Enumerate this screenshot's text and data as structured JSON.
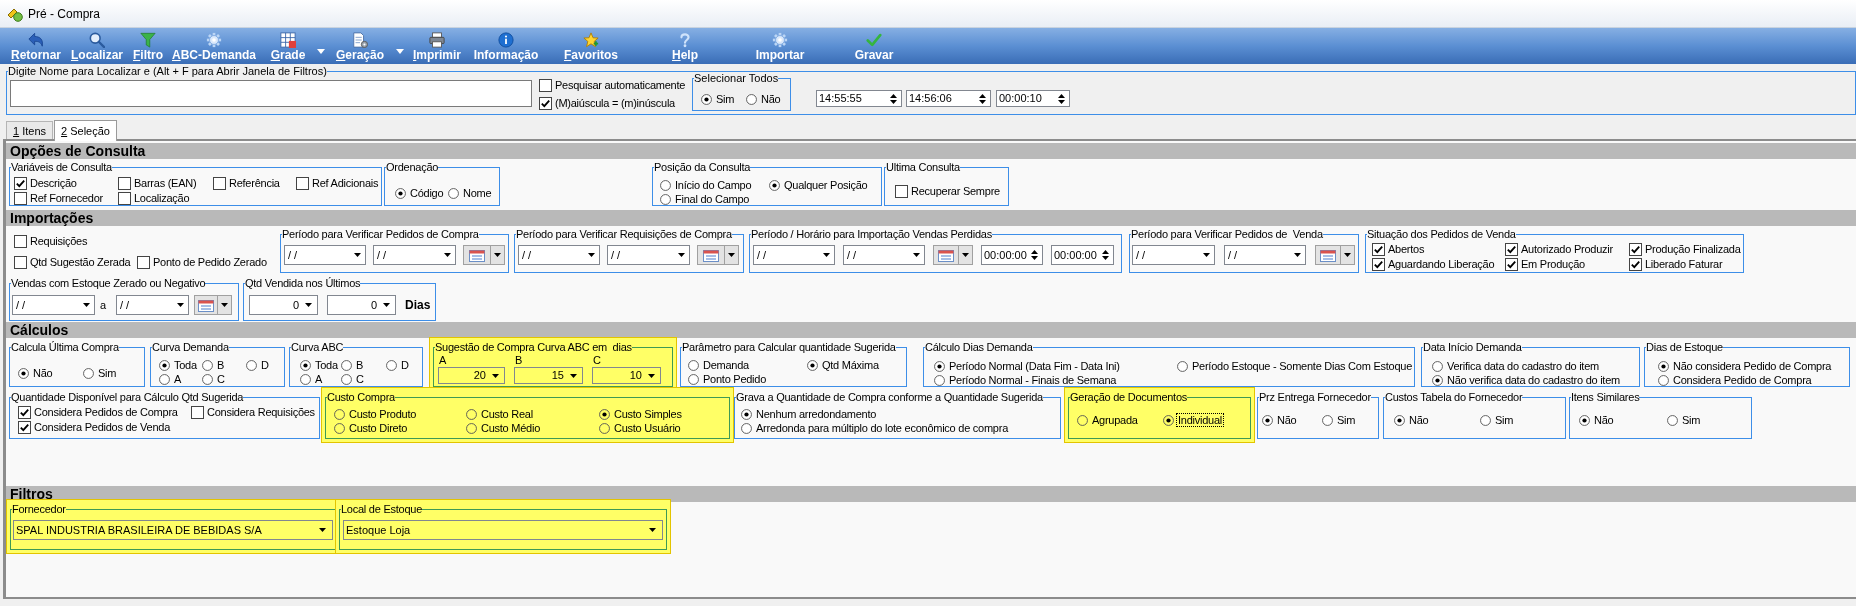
{
  "window": {
    "title": "Pré - Compra"
  },
  "toolbar": [
    {
      "label": "Retornar",
      "mnemonic": true,
      "menu": false
    },
    {
      "label": "Localizar",
      "mnemonic": true,
      "menu": false
    },
    {
      "label": "Filtro",
      "mnemonic": true,
      "menu": false
    },
    {
      "label": "ABC-Demanda",
      "mnemonic": true,
      "menu": false
    },
    {
      "label": "Grade",
      "mnemonic": true,
      "menu": true
    },
    {
      "label": "Geração",
      "mnemonic": true,
      "menu": true
    },
    {
      "label": "Imprimir",
      "mnemonic": true,
      "menu": false
    },
    {
      "label": "Informação",
      "mnemonic": false,
      "menu": false
    },
    {
      "label": "Favoritos",
      "mnemonic": true,
      "menu": false
    },
    {
      "label": "Help",
      "mnemonic": true,
      "menu": false
    },
    {
      "label": "Importar",
      "mnemonic": false,
      "menu": false
    },
    {
      "label": "Gravar",
      "mnemonic": false,
      "menu": false
    }
  ],
  "search": {
    "label": "Digite Nome para Localizar e (Alt + F para Abrir Janela de Filtros)",
    "options": [
      {
        "label": "Pesquisar automaticamente",
        "checked": false
      },
      {
        "label": "(M)aiúscula = (m)inúscula",
        "checked": true
      }
    ],
    "select_all": {
      "title": "Selecionar Todos",
      "options": [
        {
          "label": "Sim",
          "selected": true
        },
        {
          "label": "Não",
          "selected": false
        }
      ]
    },
    "times": [
      "14:55:55",
      "14:56:06",
      "00:00:10"
    ]
  },
  "tabs": [
    {
      "label": "1 Itens",
      "selected": false,
      "mnemonic": true
    },
    {
      "label": "2 Seleção",
      "selected": true,
      "mnemonic": true
    }
  ],
  "sections": [
    {
      "title": "Opções de Consulta",
      "rows": [
        {
          "groups": [
            {
              "title": "Variáveis de Consulta",
              "highlighted": false,
              "lines": [
                [
                  {
                    "kind": "checkbox",
                    "label": "Descrição",
                    "checked": true
                  },
                  {
                    "kind": "checkbox",
                    "label": "Barras (EAN)",
                    "checked": false
                  },
                  {
                    "kind": "checkbox",
                    "label": "Referência",
                    "checked": false
                  },
                  {
                    "kind": "checkbox",
                    "label": "Ref Adicionais",
                    "checked": false
                  }
                ],
                [
                  {
                    "kind": "checkbox",
                    "label": "Ref Fornecedor",
                    "checked": false
                  },
                  {
                    "kind": "checkbox",
                    "label": "Localização",
                    "checked": false
                  }
                ]
              ]
            },
            {
              "title": "Ordenação",
              "highlighted": false,
              "lines": [
                [
                  {
                    "kind": "radio",
                    "label": "Código",
                    "selected": true
                  },
                  {
                    "kind": "radio",
                    "label": "Nome",
                    "selected": false
                  }
                ]
              ]
            },
            {
              "title": "Posição da Consulta",
              "highlighted": false,
              "lines": [
                [
                  {
                    "kind": "radio",
                    "label": "Início do Campo",
                    "selected": false
                  },
                  {
                    "kind": "radio",
                    "label": "Qualquer Posição",
                    "selected": true
                  }
                ],
                [
                  {
                    "kind": "radio",
                    "label": "Final do Campo",
                    "selected": false
                  }
                ]
              ]
            },
            {
              "title": "Ultima Consulta",
              "highlighted": false,
              "lines": [
                [
                  {
                    "kind": "checkbox",
                    "label": "Recuperar Sempre",
                    "checked": false
                  }
                ]
              ]
            }
          ]
        }
      ]
    },
    {
      "title": "Importações",
      "rows": [
        {
          "groups": [
            {
              "lines": [
                [
                  {
                    "kind": "checkbox",
                    "label": "Requisições",
                    "checked": false
                  }
                ],
                [
                  {
                    "kind": "checkbox",
                    "label": "Qtd Sugestão Zerada",
                    "checked": false
                  },
                  {
                    "kind": "checkbox",
                    "label": "Ponto de Pedido Zerado",
                    "checked": false
                  }
                ]
              ]
            },
            {
              "title": "Período para Verificar Pedidos de Compra",
              "highlighted": false,
              "lines": [
                [
                  {
                    "kind": "date",
                    "value": "/ /"
                  },
                  {
                    "kind": "date",
                    "value": "/ /"
                  },
                  {
                    "kind": "calendar"
                  }
                ]
              ]
            },
            {
              "title": "Período para Verificar Requisições de Compra",
              "highlighted": false,
              "lines": [
                [
                  {
                    "kind": "date",
                    "value": "/ /"
                  },
                  {
                    "kind": "date",
                    "value": "/ /"
                  },
                  {
                    "kind": "calendar"
                  }
                ]
              ]
            },
            {
              "title": "Período / Horário para Importação Vendas Perdidas",
              "highlighted": false,
              "lines": [
                [
                  {
                    "kind": "date",
                    "value": "/ /"
                  },
                  {
                    "kind": "date",
                    "value": "/ /"
                  },
                  {
                    "kind": "calendar"
                  },
                  {
                    "kind": "time",
                    "value": "00:00:00"
                  },
                  {
                    "kind": "time",
                    "value": "00:00:00"
                  }
                ]
              ]
            },
            {
              "title": "Período para Verificar Pedidos de  Venda",
              "highlighted": false,
              "lines": [
                [
                  {
                    "kind": "date",
                    "value": "/ /"
                  },
                  {
                    "kind": "date",
                    "value": "/ /"
                  },
                  {
                    "kind": "calendar"
                  }
                ]
              ]
            },
            {
              "title": "Situação dos Pedidos de Venda",
              "highlighted": false,
              "lines": [
                [
                  {
                    "kind": "checkbox",
                    "label": "Abertos",
                    "checked": true
                  },
                  {
                    "kind": "checkbox",
                    "label": "Autorizado Produzir",
                    "checked": true
                  },
                  {
                    "kind": "checkbox",
                    "label": "Produção Finalizada",
                    "checked": true
                  }
                ],
                [
                  {
                    "kind": "checkbox",
                    "label": "Aguardando Liberação",
                    "checked": true
                  },
                  {
                    "kind": "checkbox",
                    "label": "Em Produção",
                    "checked": true
                  },
                  {
                    "kind": "checkbox",
                    "label": "Liberado Faturar",
                    "checked": true
                  }
                ]
              ]
            }
          ]
        },
        {
          "groups": [
            {
              "title": "Vendas com Estoque Zerado ou Negativo",
              "highlighted": false,
              "lines": [
                [
                  {
                    "kind": "date",
                    "value": "/ /"
                  },
                  {
                    "kind": "separator",
                    "label": "a"
                  },
                  {
                    "kind": "date",
                    "value": "/ /"
                  },
                  {
                    "kind": "calendar"
                  }
                ]
              ]
            },
            {
              "title": "Qtd Vendida nos Últimos",
              "highlighted": false,
              "lines": [
                [
                  {
                    "kind": "number",
                    "value": "0"
                  },
                  {
                    "kind": "number",
                    "value": "0"
                  },
                  {
                    "kind": "unit",
                    "label": "Dias"
                  }
                ]
              ]
            }
          ]
        }
      ]
    },
    {
      "title": "Cálculos",
      "rows": [
        {
          "groups": [
            {
              "title": "Calcula Última Compra",
              "highlighted": false,
              "lines": [
                [
                  {
                    "kind": "radio",
                    "label": "Não",
                    "selected": true
                  },
                  {
                    "kind": "radio",
                    "label": "Sim",
                    "selected": false
                  }
                ]
              ]
            },
            {
              "title": "Curva Demanda",
              "highlighted": false,
              "lines": [
                [
                  {
                    "kind": "radio",
                    "label": "Toda",
                    "selected": true
                  },
                  {
                    "kind": "radio",
                    "label": "B",
                    "selected": false
                  },
                  {
                    "kind": "radio",
                    "label": "D",
                    "selected": false
                  }
                ],
                [
                  {
                    "kind": "radio",
                    "label": "A",
                    "selected": false
                  },
                  {
                    "kind": "radio",
                    "label": "C",
                    "selected": false
                  }
                ]
              ]
            },
            {
              "title": "Curva ABC",
              "highlighted": false,
              "lines": [
                [
                  {
                    "kind": "radio",
                    "label": "Toda",
                    "selected": true
                  },
                  {
                    "kind": "radio",
                    "label": "B",
                    "selected": false
                  },
                  {
                    "kind": "radio",
                    "label": "D",
                    "selected": false
                  }
                ],
                [
                  {
                    "kind": "radio",
                    "label": "A",
                    "selected": false
                  },
                  {
                    "kind": "radio",
                    "label": "C",
                    "selected": false
                  }
                ]
              ]
            },
            {
              "title": "Sugestão de Compra Curva ABC em  dias",
              "highlighted": true,
              "lines": [
                [
                  {
                    "kind": "caption",
                    "label": "A"
                  },
                  {
                    "kind": "caption",
                    "label": "B"
                  },
                  {
                    "kind": "caption",
                    "label": "C"
                  }
                ],
                [
                  {
                    "kind": "number",
                    "value": "20"
                  },
                  {
                    "kind": "number",
                    "value": "15"
                  },
                  {
                    "kind": "number",
                    "value": "10"
                  }
                ]
              ]
            },
            {
              "title": "Parâmetro para Calcular quantidade Sugerida",
              "highlighted": false,
              "lines": [
                [
                  {
                    "kind": "radio",
                    "label": "Demanda",
                    "selected": false
                  },
                  {
                    "kind": "radio",
                    "label": "Qtd Máxima",
                    "selected": true
                  }
                ],
                [
                  {
                    "kind": "radio",
                    "label": "Ponto Pedido",
                    "selected": false
                  }
                ]
              ]
            },
            {
              "title": "Cálculo Dias Demanda",
              "highlighted": false,
              "lines": [
                [
                  {
                    "kind": "radio",
                    "label": "Período Normal (Data Fim - Data Ini)",
                    "selected": true
                  },
                  {
                    "kind": "radio",
                    "label": "Período Estoque - Somente Dias Com Estoque",
                    "selected": false
                  }
                ],
                [
                  {
                    "kind": "radio",
                    "label": "Período Normal - Finais de Semana",
                    "selected": false
                  }
                ]
              ]
            },
            {
              "title": "Data Início Demanda",
              "highlighted": false,
              "lines": [
                [
                  {
                    "kind": "radio",
                    "label": "Verifica data do cadastro do item",
                    "selected": false
                  }
                ],
                [
                  {
                    "kind": "radio",
                    "label": "Não verifica data do cadastro do item",
                    "selected": true
                  }
                ]
              ]
            },
            {
              "title": "Dias de Estoque",
              "highlighted": false,
              "lines": [
                [
                  {
                    "kind": "radio",
                    "label": "Não considera Pedido de Compra",
                    "selected": true
                  }
                ],
                [
                  {
                    "kind": "radio",
                    "label": "Considera Pedido de Compra",
                    "selected": false
                  }
                ]
              ]
            }
          ]
        },
        {
          "groups": [
            {
              "title": "Quantidade Disponível para Cálculo Qtd Sugerida",
              "highlighted": false,
              "lines": [
                [
                  {
                    "kind": "checkbox",
                    "label": "Considera Pedidos de Compra",
                    "checked": true
                  },
                  {
                    "kind": "checkbox",
                    "label": "Considera Requisições",
                    "checked": false
                  }
                ],
                [
                  {
                    "kind": "checkbox",
                    "label": "Considera Pedidos de Venda",
                    "checked": true
                  }
                ]
              ]
            },
            {
              "title": "Custo Compra",
              "highlighted": true,
              "lines": [
                [
                  {
                    "kind": "radio",
                    "label": "Custo Produto",
                    "selected": false
                  },
                  {
                    "kind": "radio",
                    "label": "Custo Real",
                    "selected": false
                  },
                  {
                    "kind": "radio",
                    "label": "Custo Simples",
                    "selected": true
                  }
                ],
                [
                  {
                    "kind": "radio",
                    "label": "Custo Direto",
                    "selected": false
                  },
                  {
                    "kind": "radio",
                    "label": "Custo Médio",
                    "selected": false
                  },
                  {
                    "kind": "radio",
                    "label": "Custo Usuário",
                    "selected": false
                  }
                ]
              ]
            },
            {
              "title": "Grava a Quantidade de Compra conforme a Quantidade Sugerida",
              "highlighted": false,
              "lines": [
                [
                  {
                    "kind": "radio",
                    "label": "Nenhum arredondamento",
                    "selected": true
                  }
                ],
                [
                  {
                    "kind": "radio",
                    "label": "Arredonda para múltiplo do lote econômico de compra",
                    "selected": false
                  }
                ]
              ]
            },
            {
              "title": "Geração de Documentos",
              "highlighted": true,
              "lines": [
                [
                  {
                    "kind": "radio",
                    "label": "Agrupada",
                    "selected": false,
                    "focused": false
                  },
                  {
                    "kind": "radio",
                    "label": "Individual",
                    "selected": true,
                    "focused": true
                  }
                ]
              ]
            },
            {
              "title": "Prz Entrega Fornecedor",
              "highlighted": false,
              "lines": [
                [
                  {
                    "kind": "radio",
                    "label": "Não",
                    "selected": true
                  },
                  {
                    "kind": "radio",
                    "label": "Sim",
                    "selected": false
                  }
                ]
              ]
            },
            {
              "title": "Custos Tabela do Fornecedor",
              "highlighted": false,
              "lines": [
                [
                  {
                    "kind": "radio",
                    "label": "Não",
                    "selected": true
                  },
                  {
                    "kind": "radio",
                    "label": "Sim",
                    "selected": false
                  }
                ]
              ]
            },
            {
              "title": "Itens Similares",
              "highlighted": false,
              "lines": [
                [
                  {
                    "kind": "radio",
                    "label": "Não",
                    "selected": true
                  },
                  {
                    "kind": "radio",
                    "label": "Sim",
                    "selected": false
                  }
                ]
              ]
            }
          ]
        }
      ]
    },
    {
      "title": "Filtros",
      "rows": [
        {
          "groups": [
            {
              "title": "Fornecedor",
              "highlighted": true,
              "lines": [
                [
                  {
                    "kind": "combo",
                    "value": "SPAL INDUSTRIA BRASILEIRA DE BEBIDAS S/A"
                  }
                ]
              ]
            },
            {
              "title": "Local de Estoque",
              "highlighted": true,
              "lines": [
                [
                  {
                    "kind": "combo",
                    "value": "Estoque Loja"
                  }
                ]
              ]
            }
          ]
        }
      ]
    }
  ]
}
